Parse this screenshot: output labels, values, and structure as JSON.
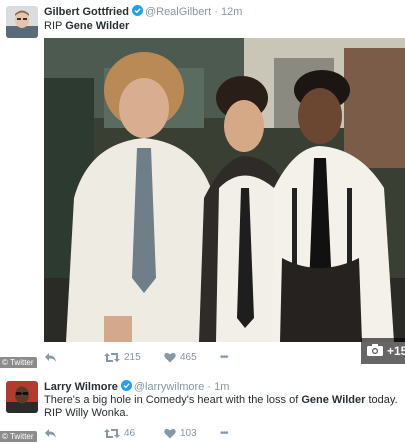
{
  "tweet1": {
    "author_name": "Gilbert Gottfried",
    "handle": "@RealGilbert",
    "separator": "·",
    "time": "12m",
    "text_prefix": "RIP ",
    "text_bold": "Gene Wilder",
    "retweets": "215",
    "likes": "465",
    "more": "•••",
    "photo_count": "+15",
    "watermark": "© Twitter"
  },
  "tweet2": {
    "author_name": "Larry Wilmore",
    "handle": "@larrywilmore",
    "separator": "·",
    "time": "1m",
    "text_part1": "There's a big hole in Comedy's heart with the loss of ",
    "text_bold": "Gene Wilder",
    "text_part2": " today. RIP Willy Wonka.",
    "retweets": "46",
    "likes": "103",
    "more": "•••",
    "watermark": "© Twitter"
  },
  "colors": {
    "name": "#292f33",
    "meta": "#8899a6",
    "verified": "#1da1f2",
    "divider": "#e1e8ed"
  },
  "icons": [
    "reply-icon",
    "retweet-icon",
    "like-icon",
    "more-icon",
    "camera-icon",
    "verified-badge-icon"
  ]
}
